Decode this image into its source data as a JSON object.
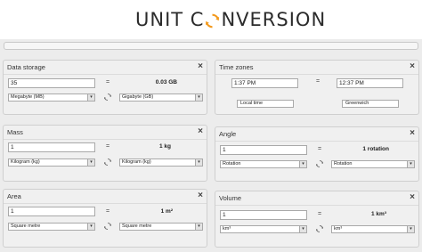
{
  "app": {
    "title_before": "UNIT C",
    "title_after": "NVERSION"
  },
  "panels": {
    "data_storage": {
      "title": "Data storage",
      "value": "35",
      "equals": "=",
      "result": "0.03 GB",
      "from_unit": "Megabyte (MB)",
      "to_unit": "Gigabyte (GB)"
    },
    "time_zones": {
      "title": "Time zones",
      "value": "1:37 PM",
      "equals": "=",
      "result": "12:37 PM",
      "from_zone": "Local time",
      "to_zone": "Greenwich"
    },
    "mass": {
      "title": "Mass",
      "value": "1",
      "equals": "=",
      "result": "1 kg",
      "from_unit": "Kilogram (kg)",
      "to_unit": "Kilogram (kg)"
    },
    "angle": {
      "title": "Angle",
      "value": "1",
      "equals": "=",
      "result": "1 rotation",
      "from_unit": "Rotation",
      "to_unit": "Rotation"
    },
    "area": {
      "title": "Area",
      "value": "1",
      "equals": "=",
      "result": "1 m²",
      "from_unit": "Square metre",
      "to_unit": "Square metre"
    },
    "volume": {
      "title": "Volume",
      "value": "1",
      "equals": "=",
      "result": "1 km³",
      "from_unit": "km³",
      "to_unit": "km³"
    }
  },
  "icons": {
    "close": "×",
    "dropdown": "▾"
  },
  "colors": {
    "accent_orange": "#f39a1e",
    "panel_bg": "#f0f0f0",
    "page_bg": "#ececec"
  }
}
